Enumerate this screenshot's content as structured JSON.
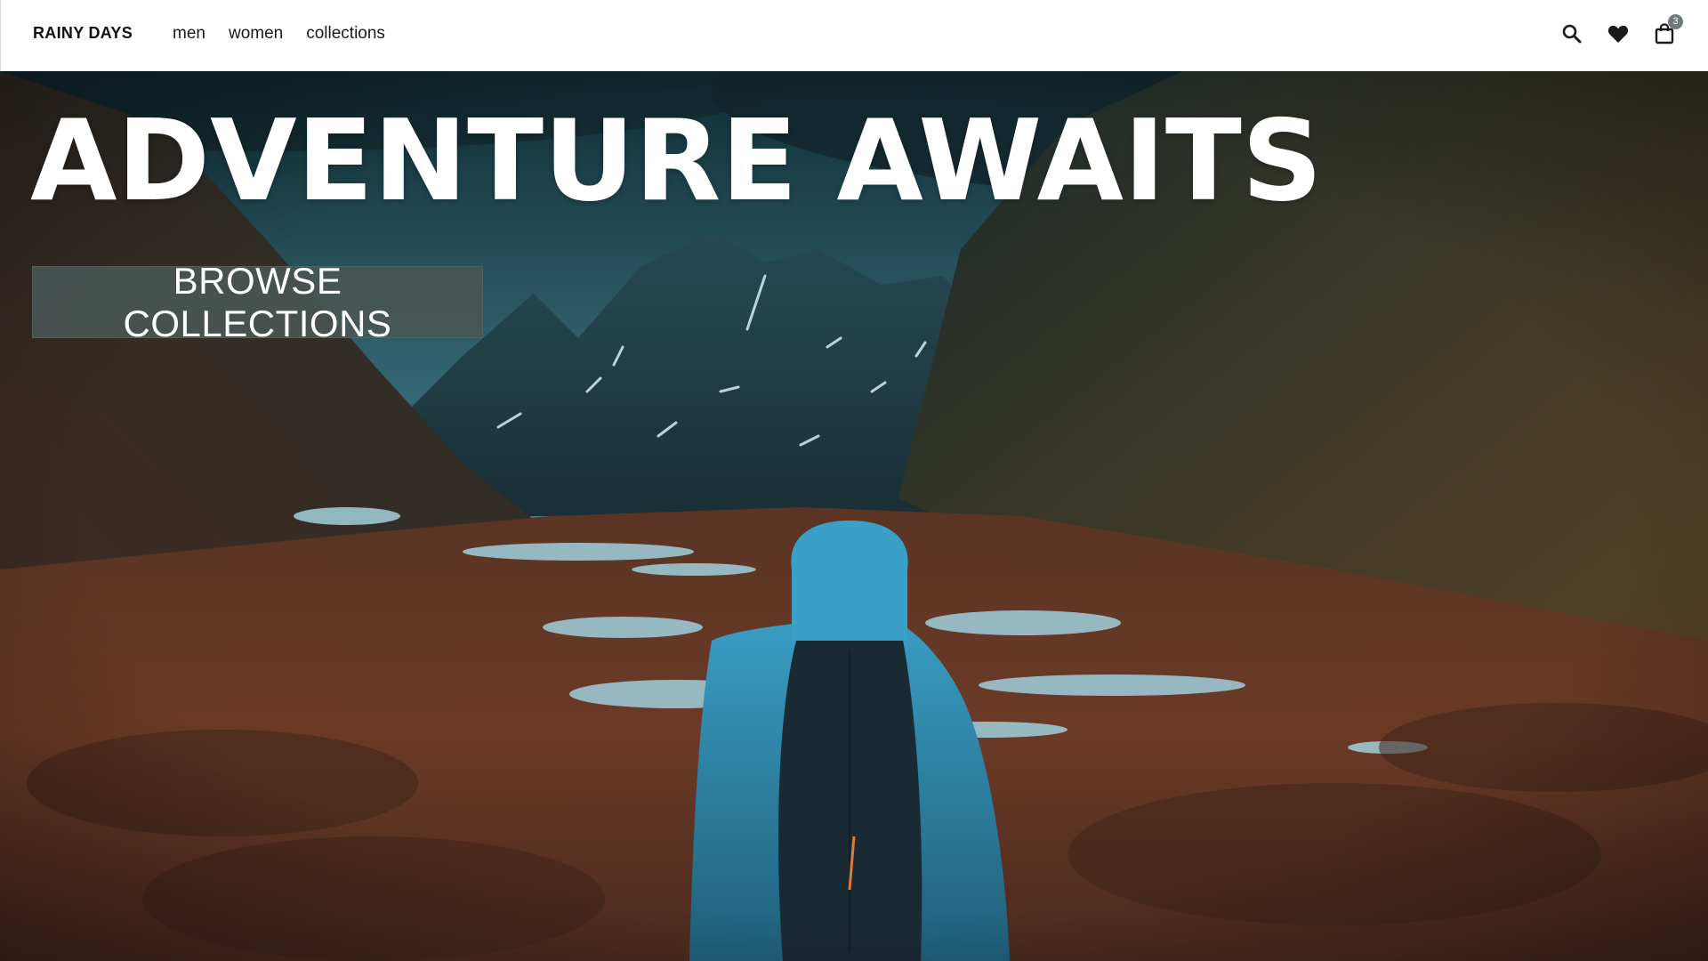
{
  "header": {
    "logo": "RAINY DAYS",
    "nav": [
      {
        "label": "men"
      },
      {
        "label": "women"
      },
      {
        "label": "collections"
      }
    ],
    "actions": {
      "search_icon": "search-icon",
      "wishlist_icon": "heart-icon",
      "cart_icon": "shopping-bag-icon",
      "cart_count": "3"
    }
  },
  "hero": {
    "title": "ADVENTURE AWAITS",
    "cta_label": "BROWSE COLLECTIONS",
    "image_subject": "hiker in blue rain jacket facing a rainy mountain valley"
  },
  "colors": {
    "header_bg": "#ffffff",
    "text_dark": "#111111",
    "cta_bg": "#4a5654",
    "hero_text": "#ffffff",
    "jacket_blue": "#2f86a8",
    "terrain_brown": "#6b3a28"
  }
}
